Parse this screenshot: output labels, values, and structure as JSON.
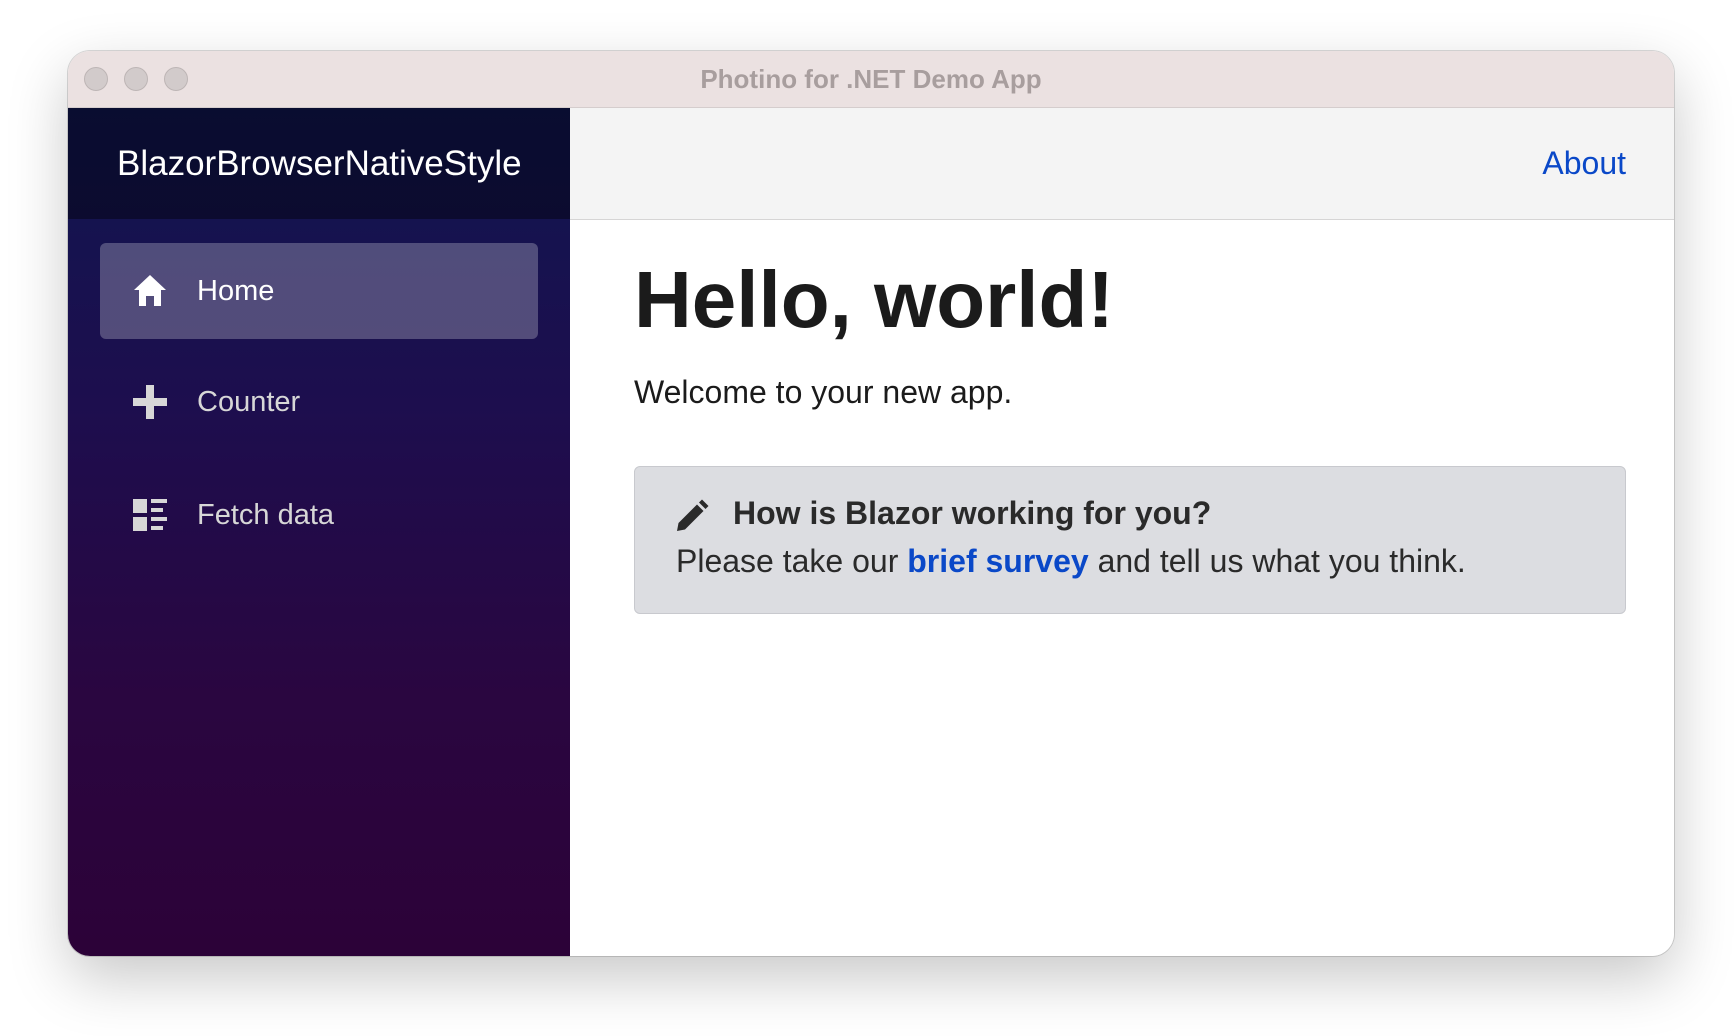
{
  "window": {
    "title": "Photino for .NET Demo App"
  },
  "sidebar": {
    "brand": "BlazorBrowserNativeStyle",
    "items": [
      {
        "label": "Home",
        "icon": "home-icon",
        "active": true
      },
      {
        "label": "Counter",
        "icon": "plus-icon",
        "active": false
      },
      {
        "label": "Fetch data",
        "icon": "list-rich-icon",
        "active": false
      }
    ]
  },
  "header": {
    "about_label": "About"
  },
  "main": {
    "title": "Hello, world!",
    "welcome": "Welcome to your new app.",
    "survey": {
      "icon": "pencil-icon",
      "heading": "How is Blazor working for you?",
      "text_before": "Please take our",
      "link_label": "brief survey",
      "text_after": "and tell us what you think."
    }
  },
  "colors": {
    "link": "#0a48c8",
    "sidebar_top": "#101650",
    "sidebar_bottom": "#2c0238",
    "alert_bg": "#dcdde1"
  }
}
